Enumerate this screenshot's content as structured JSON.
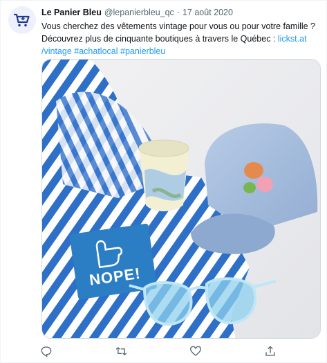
{
  "author": {
    "display_name": "Le Panier Bleu",
    "handle": "@lepanierbleu_qc",
    "separator": "·",
    "date": "17 août 2020",
    "avatar_icon": "shopping-cart-fleur-de-lis-icon",
    "brand_color": "#1f3a93"
  },
  "tweet": {
    "text_1": "Vous cherchez des vêtements vintage pour vous ou pour votre famille ? Découvrez plus de cinquante boutiques à travers le Québec : ",
    "link_1": "lickst.at",
    "link_2": "/vintage",
    "space": " ",
    "hashtag_1": "#achatlocal",
    "hashtag_2": "#panierbleu",
    "link_color": "#1d9bf0"
  },
  "media": {
    "sticker_text": "NOPE!",
    "sticker_icon": "thumbs-up-icon"
  },
  "actions": {
    "reply_icon": "reply-icon",
    "retweet_icon": "retweet-icon",
    "like_icon": "heart-icon",
    "share_icon": "share-icon"
  }
}
